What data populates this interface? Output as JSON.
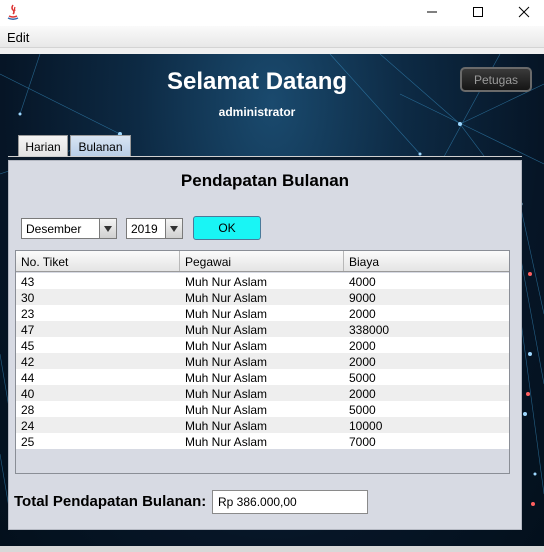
{
  "window": {
    "title_icon": "java-icon",
    "min_icon": "minimize-icon",
    "max_icon": "maximize-icon",
    "close_icon": "close-icon"
  },
  "menu": {
    "edit": "Edit"
  },
  "header": {
    "welcome": "Selamat Datang",
    "user": "administrator",
    "petugas_button": "Petugas"
  },
  "tabs": [
    {
      "label": "Harian",
      "selected": false
    },
    {
      "label": "Bulanan",
      "selected": true
    }
  ],
  "panel": {
    "title": "Pendapatan Bulanan",
    "month_value": "Desember",
    "year_value": "2019",
    "ok_label": "OK"
  },
  "table": {
    "columns": [
      "No. Tiket",
      "Pegawai",
      "Biaya"
    ],
    "rows": [
      [
        "43",
        "Muh Nur Aslam",
        "4000"
      ],
      [
        "30",
        "Muh Nur Aslam",
        "9000"
      ],
      [
        "23",
        "Muh Nur Aslam",
        "2000"
      ],
      [
        "47",
        "Muh Nur Aslam",
        "338000"
      ],
      [
        "45",
        "Muh Nur Aslam",
        "2000"
      ],
      [
        "42",
        "Muh Nur Aslam",
        "2000"
      ],
      [
        "44",
        "Muh Nur Aslam",
        "5000"
      ],
      [
        "40",
        "Muh Nur Aslam",
        "2000"
      ],
      [
        "28",
        "Muh Nur Aslam",
        "5000"
      ],
      [
        "24",
        "Muh Nur Aslam",
        "10000"
      ],
      [
        "25",
        "Muh Nur Aslam",
        "7000"
      ]
    ]
  },
  "total": {
    "label": "Total Pendapatan Bulanan:",
    "value": "Rp 386.000,00"
  },
  "colors": {
    "ok_button": "#19f5f5",
    "background": "#0d2a44",
    "panel": "#d7dae3"
  }
}
